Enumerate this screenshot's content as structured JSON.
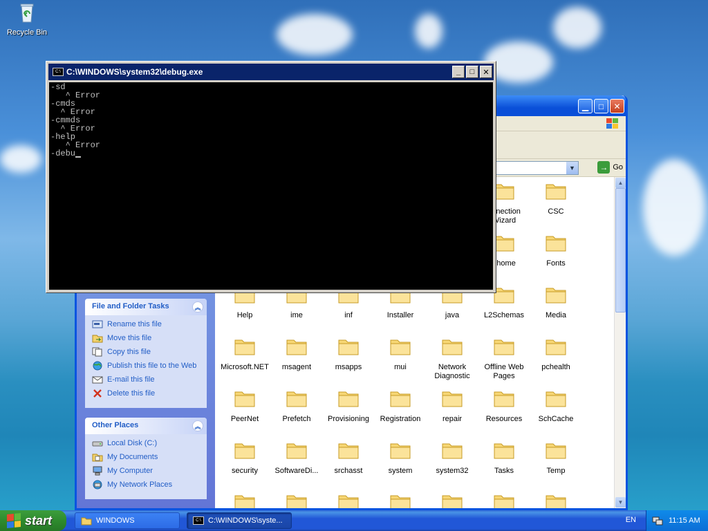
{
  "desktop": {
    "recycle_bin_label": "Recycle Bin"
  },
  "cmd_window": {
    "title": "C:\\WINDOWS\\system32\\debug.exe",
    "lines": [
      "-sd",
      "   ^ Error",
      "-cmds",
      "  ^ Error",
      "-cmmds",
      "  ^ Error",
      "-help",
      "   ^ Error",
      "-debu"
    ]
  },
  "explorer": {
    "address_go_label": "Go",
    "file_tasks": {
      "title": "File and Folder Tasks",
      "items": [
        {
          "label": "Rename this file",
          "icon": "rename-icon"
        },
        {
          "label": "Move this file",
          "icon": "move-icon"
        },
        {
          "label": "Copy this file",
          "icon": "copy-icon"
        },
        {
          "label": "Publish this file to the Web",
          "icon": "publish-icon"
        },
        {
          "label": "E-mail this file",
          "icon": "email-icon"
        },
        {
          "label": "Delete this file",
          "icon": "delete-icon"
        }
      ]
    },
    "other_places": {
      "title": "Other Places",
      "items": [
        {
          "label": "Local Disk (C:)",
          "icon": "disk-icon"
        },
        {
          "label": "My Documents",
          "icon": "documents-icon"
        },
        {
          "label": "My Computer",
          "icon": "computer-icon"
        },
        {
          "label": "My Network Places",
          "icon": "network-icon"
        }
      ]
    },
    "folders": [
      {
        "label": "onnection Wizard"
      },
      {
        "label": "CSC"
      },
      {
        "label": "ehome"
      },
      {
        "label": "Fonts"
      },
      {
        "label": "Help"
      },
      {
        "label": "ime"
      },
      {
        "label": "inf"
      },
      {
        "label": "Installer"
      },
      {
        "label": "java"
      },
      {
        "label": "L2Schemas"
      },
      {
        "label": "Media"
      },
      {
        "label": "Microsoft.NET"
      },
      {
        "label": "msagent"
      },
      {
        "label": "msapps"
      },
      {
        "label": "mui"
      },
      {
        "label": "Network Diagnostic"
      },
      {
        "label": "Offline Web Pages"
      },
      {
        "label": "pchealth"
      },
      {
        "label": "PeerNet"
      },
      {
        "label": "Prefetch"
      },
      {
        "label": "Provisioning"
      },
      {
        "label": "Registration"
      },
      {
        "label": "repair"
      },
      {
        "label": "Resources"
      },
      {
        "label": "SchCache"
      },
      {
        "label": "security"
      },
      {
        "label": "SoftwareDi..."
      },
      {
        "label": "srchasst"
      },
      {
        "label": "system"
      },
      {
        "label": "system32"
      },
      {
        "label": "Tasks"
      },
      {
        "label": "Temp"
      }
    ]
  },
  "taskbar": {
    "start_label": "start",
    "buttons": [
      {
        "label": "WINDOWS"
      },
      {
        "label": "C:\\WINDOWS\\syste..."
      }
    ],
    "language": "EN",
    "clock": "11:15 AM"
  }
}
